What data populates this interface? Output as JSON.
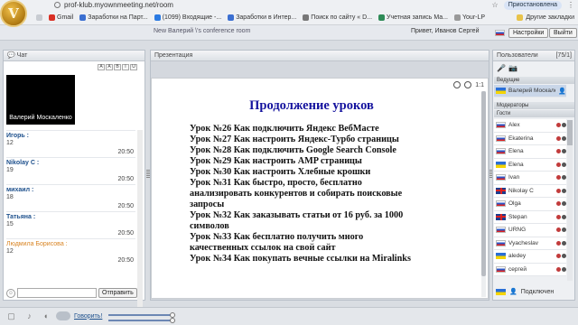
{
  "browser": {
    "url": "prof-klub.myownmeeting.net/room",
    "profile_label": "Приостановлена",
    "bookmarks": [
      {
        "label": "Gmail",
        "color": "#d93025"
      },
      {
        "label": "Заработки на Парт...",
        "color": "#3b6fd1"
      },
      {
        "label": "(1099) Входящие -...",
        "color": "#2a7ae2"
      },
      {
        "label": "Заработки в Интер...",
        "color": "#3b6fd1"
      },
      {
        "label": "Поиск по сайту « D...",
        "color": "#777777"
      },
      {
        "label": "Учетная запись Ма...",
        "color": "#2e8b57"
      },
      {
        "label": "Your-LP",
        "color": "#999999"
      }
    ],
    "other_bookmarks": "Другие закладки"
  },
  "header": {
    "room_title": "New Валерий \\'s conference room",
    "greeting": "Привет, Иванов Сергей",
    "settings_label": "Настройки",
    "logout_label": "Выйти"
  },
  "chat": {
    "title": "Чат",
    "tools": [
      "A",
      "A",
      "B",
      "I",
      "U"
    ],
    "video_label": "Валерий Москаленко",
    "messages": [
      {
        "name": "Игорь :",
        "text": "12",
        "time": "20:50"
      },
      {
        "name": "Nikolay C :",
        "text": "19",
        "time": "20:50"
      },
      {
        "name": "михаил :",
        "text": "18",
        "time": "20:50"
      },
      {
        "name": "Татьяна :",
        "text": "15",
        "time": "20:50"
      },
      {
        "name": "Людмила Борисова :",
        "text": "12",
        "time": "20:50"
      }
    ],
    "send_label": "Отправить"
  },
  "presentation": {
    "title": "Презентация",
    "zoom_label": "1:1",
    "slide_title": "Продолжение уроков",
    "lessons": [
      "Урок №26 Как подключить Яндекс ВебМасте",
      "Урок №27 Как настроить Яндекс-Турбо страницы",
      "Урок №28 Как подключить Google Search Console",
      "Урок №29 Как настроить AMP страницы",
      "Урок №30 Как настроить Хлебные крошки",
      "Урок №31 Как быстро, просто, бесплатно",
      "анализировать конкурентов и собирать поисковые",
      "запросы",
      "Урок №32 Как заказывать статьи от 16 руб. за 1000",
      "символов",
      "Урок №33 Как бесплатно получить много",
      "качественных ссылок на свой сайт",
      "Урок №34 Как покупать вечные ссылки на Miralinks"
    ]
  },
  "users": {
    "title": "Пользователи",
    "count": "[75/1]",
    "sections": {
      "leaders": "Ведущие",
      "moderators": "Модераторы",
      "guests": "Гости"
    },
    "leader": {
      "name": "Валерий Москаленко",
      "flag": "ua"
    },
    "guests": [
      {
        "name": "Alex",
        "flag": "ru"
      },
      {
        "name": "Ekaterina",
        "flag": "ru"
      },
      {
        "name": "Elena",
        "flag": "ru"
      },
      {
        "name": "Elena",
        "flag": "ua"
      },
      {
        "name": "Ivan",
        "flag": "ru"
      },
      {
        "name": "Nikolay C",
        "flag": "gb"
      },
      {
        "name": "Olga",
        "flag": "ru"
      },
      {
        "name": "Stepan",
        "flag": "gb"
      },
      {
        "name": "URNG",
        "flag": "ru"
      },
      {
        "name": "Vyacheslav",
        "flag": "ru"
      },
      {
        "name": "aledey",
        "flag": "ua"
      },
      {
        "name": "сергей",
        "flag": "ru"
      }
    ],
    "connected_label": "Подключен"
  },
  "bottom": {
    "talk_label": "Говорить!"
  }
}
